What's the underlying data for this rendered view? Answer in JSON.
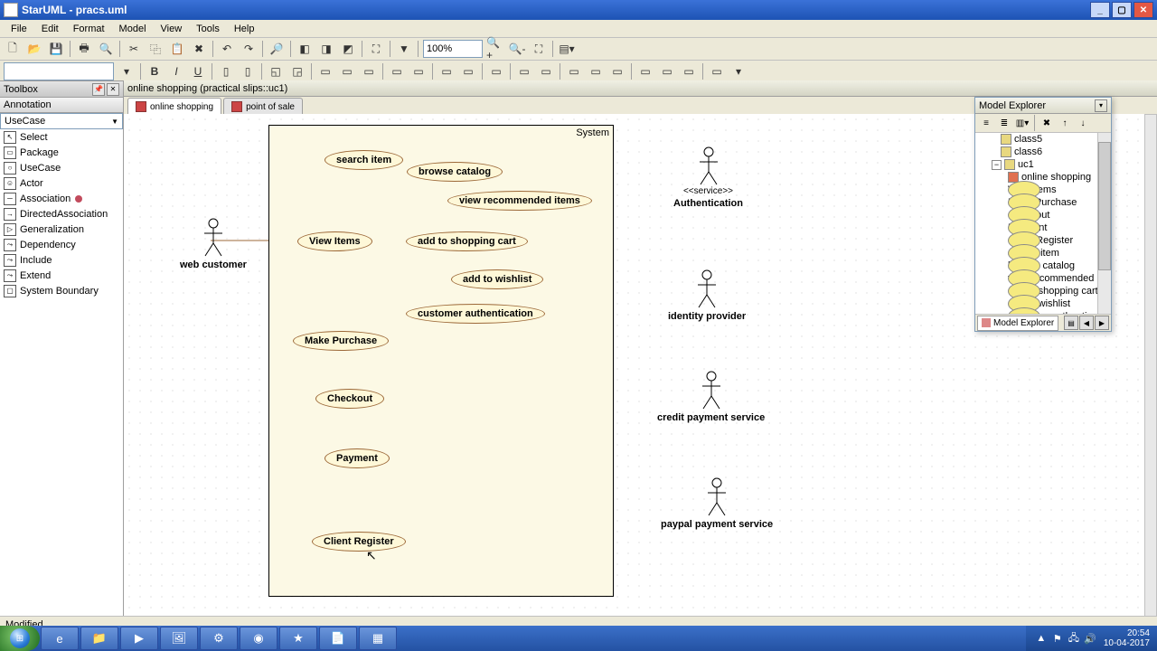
{
  "window": {
    "title": "StarUML - pracs.uml"
  },
  "menu": [
    "File",
    "Edit",
    "Format",
    "Model",
    "View",
    "Tools",
    "Help"
  ],
  "zoom": "100%",
  "toolbox": {
    "title": "Toolbox",
    "section_annotation": "Annotation",
    "section_usecase": "UseCase",
    "items": [
      "Select",
      "Package",
      "UseCase",
      "Actor",
      "Association",
      "DirectedAssociation",
      "Generalization",
      "Dependency",
      "Include",
      "Extend",
      "System Boundary"
    ]
  },
  "doc": {
    "header": "online shopping (practical slips::uc1)",
    "tabs": [
      {
        "label": "online shopping",
        "active": true
      },
      {
        "label": "point of sale",
        "active": false
      }
    ]
  },
  "diagram": {
    "system_label": "System",
    "usecases": {
      "search_item": "search item",
      "browse_catalog": "browse catalog",
      "view_recommended": "view recommended items",
      "view_items": "View Items",
      "add_cart": "add to shopping cart",
      "add_wishlist": "add to wishlist",
      "cust_auth": "customer authentication",
      "make_purchase": "Make Purchase",
      "checkout": "Checkout",
      "payment": "Payment",
      "client_register": "Client Register"
    },
    "actors": {
      "web_customer": "web customer",
      "authentication": "Authentication",
      "auth_stereo": "<<service>>",
      "identity_provider": "identity provider",
      "credit_payment": "credit payment service",
      "paypal": "paypal payment service"
    }
  },
  "explorer": {
    "title": "Model Explorer",
    "nodes": [
      {
        "icon": "pkg",
        "indent": 28,
        "label": "class5"
      },
      {
        "icon": "pkg",
        "indent": 28,
        "label": "class6"
      },
      {
        "icon": "pkg",
        "indent": 18,
        "label": "uc1",
        "exp": "−"
      },
      {
        "icon": "dg",
        "indent": 36,
        "label": "online shopping"
      },
      {
        "icon": "uc",
        "indent": 36,
        "label": "View Items"
      },
      {
        "icon": "uc",
        "indent": 36,
        "label": "Make Purchase"
      },
      {
        "icon": "uc",
        "indent": 36,
        "label": "Checkout"
      },
      {
        "icon": "uc",
        "indent": 36,
        "label": "Payment"
      },
      {
        "icon": "uc",
        "indent": 36,
        "label": "Client Register"
      },
      {
        "icon": "uc",
        "indent": 36,
        "label": "search item"
      },
      {
        "icon": "uc",
        "indent": 36,
        "label": "browse catalog"
      },
      {
        "icon": "uc",
        "indent": 36,
        "label": "view recommended items"
      },
      {
        "icon": "uc",
        "indent": 36,
        "label": "add to shopping cart"
      },
      {
        "icon": "uc",
        "indent": 36,
        "label": "add to wishlist"
      },
      {
        "icon": "uc",
        "indent": 36,
        "label": "customer authentication"
      }
    ],
    "bottom_tab": "Model Explorer"
  },
  "status": "Modified",
  "clock": {
    "time": "20:54",
    "date": "10-04-2017"
  }
}
